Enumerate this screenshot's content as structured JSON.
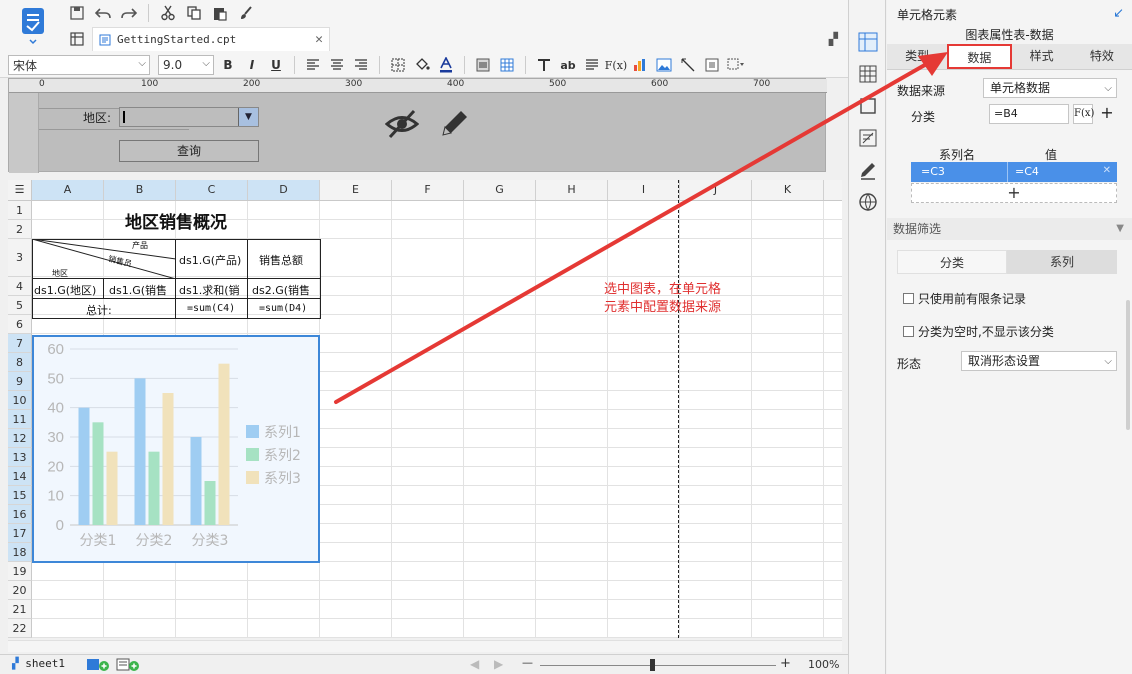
{
  "toolbar": {
    "file_tab": "GettingStarted.cpt",
    "font_name": "宋体",
    "font_size": "9.0",
    "bold": "B",
    "italic": "I",
    "underline": "U",
    "abc_label": "ab",
    "formula_label": "F(x)"
  },
  "param_area": {
    "label": "地区:",
    "query_button": "查询"
  },
  "grid": {
    "columns": [
      "A",
      "B",
      "C",
      "D",
      "E",
      "F",
      "G",
      "H",
      "I",
      "J",
      "K"
    ],
    "rows": [
      "1",
      "2",
      "3",
      "4",
      "5",
      "6",
      "7",
      "8",
      "9",
      "10",
      "11",
      "12",
      "13",
      "14",
      "15",
      "16",
      "17",
      "18",
      "19",
      "20",
      "21",
      "22"
    ],
    "title": "地区销售概况",
    "diag_product": "产品",
    "diag_sales": "销售员",
    "diag_region": "地区",
    "c3": "ds1.G(产品)",
    "d3": "销售总额",
    "a4": "ds1.G(地区)",
    "b4": "ds1.G(销售",
    "c4": "ds1.求和(销",
    "d4": "ds2.G(销售",
    "a5": "总计:",
    "c5": "=sum(C4)",
    "d5": "=sum(D4)",
    "annotation_line1": "选中图表，在单元格",
    "annotation_line2": "元素中配置数据来源"
  },
  "chart_data": {
    "type": "bar",
    "categories": [
      "分类1",
      "分类2",
      "分类3"
    ],
    "series": [
      {
        "name": "系列1",
        "values": [
          40,
          50,
          30
        ],
        "color": "#9fcdf2"
      },
      {
        "name": "系列2",
        "values": [
          35,
          25,
          15
        ],
        "color": "#a6e2c3"
      },
      {
        "name": "系列3",
        "values": [
          25,
          45,
          55
        ],
        "color": "#f1e2bb"
      }
    ],
    "ylim": [
      0,
      60
    ],
    "yticks": [
      0,
      10,
      20,
      30,
      40,
      50,
      60
    ],
    "grid": true,
    "legend": "right"
  },
  "status": {
    "sheet": "sheet1",
    "zoom": "100%",
    "minus": "—",
    "plus": "+"
  },
  "panel": {
    "title": "单元格元素",
    "subtitle": "图表属性表-数据",
    "tabs": [
      "类型",
      "数据",
      "样式",
      "特效"
    ],
    "data_source_label": "数据来源",
    "data_source_value": "单元格数据",
    "category_label": "分类",
    "category_value": "=B4",
    "fx_button": "F(x)",
    "add_symbol": "+",
    "series_name_header": "系列名",
    "value_header": "值",
    "series_name_value": "=C3",
    "series_value": "=C4",
    "filter_section": "数据筛选",
    "filter_tabs": [
      "分类",
      "系列"
    ],
    "check1": "只使用前有限条记录",
    "check2": "分类为空时,不显示该分类",
    "shape_label": "形态",
    "shape_value": "取消形态设置"
  }
}
